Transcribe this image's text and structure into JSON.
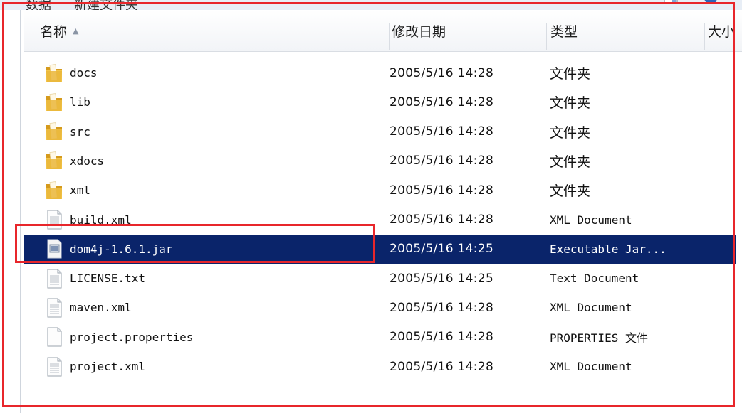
{
  "toolbar": {
    "breadcrumb_prev": "数据",
    "breadcrumb_current": "新建文件夹"
  },
  "columns": {
    "name": "名称",
    "modified": "修改日期",
    "type": "类型",
    "size": "大小"
  },
  "files": [
    {
      "name": "docs",
      "modified": "2005/5/16 14:28",
      "type": "文件夹",
      "icon": "folder-icon"
    },
    {
      "name": "lib",
      "modified": "2005/5/16 14:28",
      "type": "文件夹",
      "icon": "folder-icon"
    },
    {
      "name": "src",
      "modified": "2005/5/16 14:28",
      "type": "文件夹",
      "icon": "folder-icon"
    },
    {
      "name": "xdocs",
      "modified": "2005/5/16 14:28",
      "type": "文件夹",
      "icon": "folder-icon"
    },
    {
      "name": "xml",
      "modified": "2005/5/16 14:28",
      "type": "文件夹",
      "icon": "folder-icon"
    },
    {
      "name": "build.xml",
      "modified": "2005/5/16 14:28",
      "type": "XML Document",
      "icon": "document-icon"
    },
    {
      "name": "dom4j-1.6.1.jar",
      "modified": "2005/5/16 14:25",
      "type": "Executable Jar...",
      "icon": "jar-file-icon",
      "selected": true
    },
    {
      "name": "LICENSE.txt",
      "modified": "2005/5/16 14:25",
      "type": "Text Document",
      "icon": "document-icon"
    },
    {
      "name": "maven.xml",
      "modified": "2005/5/16 14:28",
      "type": "XML Document",
      "icon": "document-icon"
    },
    {
      "name": "project.properties",
      "modified": "2005/5/16 14:28",
      "type": "PROPERTIES 文件",
      "icon": "blank-file-icon"
    },
    {
      "name": "project.xml",
      "modified": "2005/5/16 14:28",
      "type": "XML Document",
      "icon": "document-icon"
    }
  ],
  "colors": {
    "selection": "#0a246a",
    "annotation": "#e8262b",
    "folder": "#e8b636"
  }
}
